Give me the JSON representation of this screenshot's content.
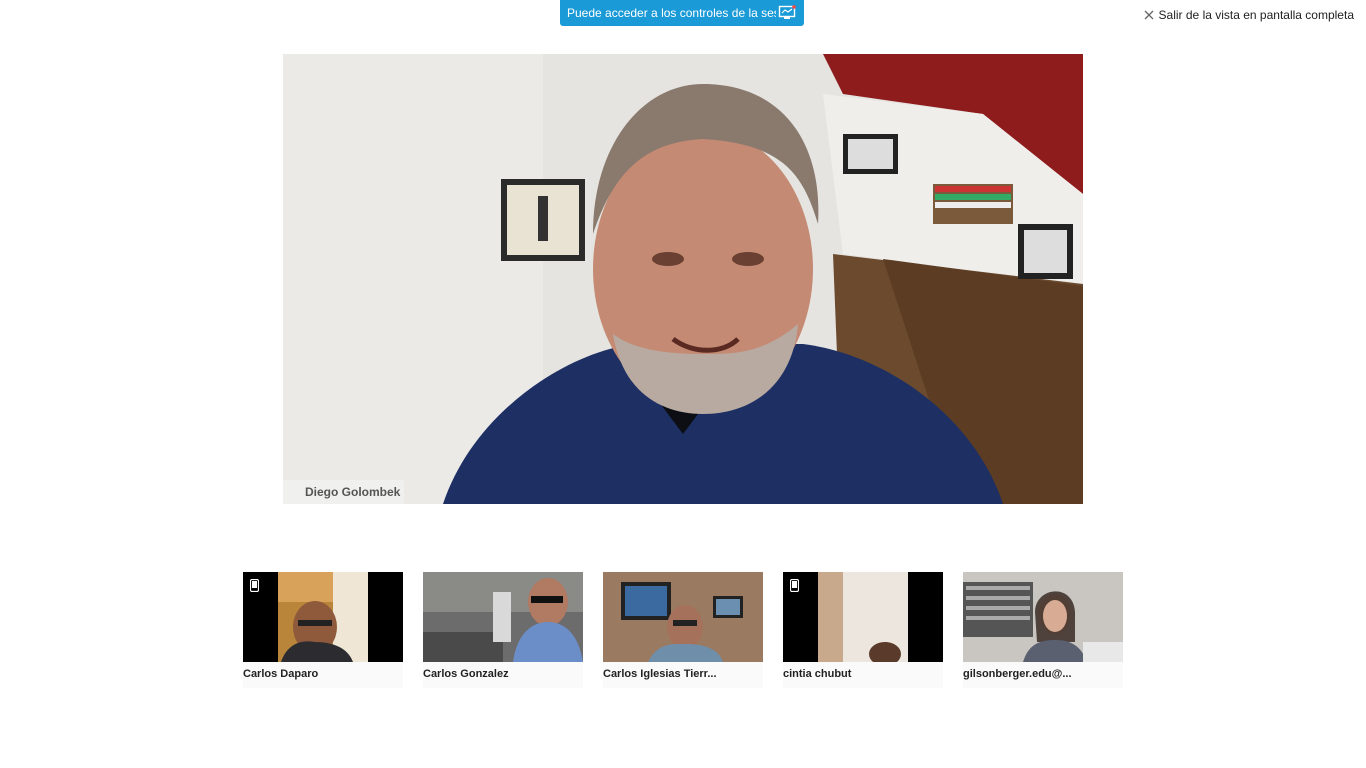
{
  "banner": {
    "text": "Puede acceder a los controles de la ses...",
    "icon": "screen-share-icon",
    "color": "#1a9ad6"
  },
  "exit_fullscreen": {
    "label": "Salir de la vista en pantalla completa",
    "icon": "close-icon"
  },
  "main_video": {
    "participant": "Diego Golombek"
  },
  "thumbnails": [
    {
      "name": "Carlos Daparo",
      "mobile": true
    },
    {
      "name": "Carlos Gonzalez",
      "mobile": false
    },
    {
      "name": "Carlos Iglesias Tierr...",
      "mobile": false
    },
    {
      "name": "cintia chubut",
      "mobile": true
    },
    {
      "name": "gilsonberger.edu@...",
      "mobile": false
    }
  ]
}
